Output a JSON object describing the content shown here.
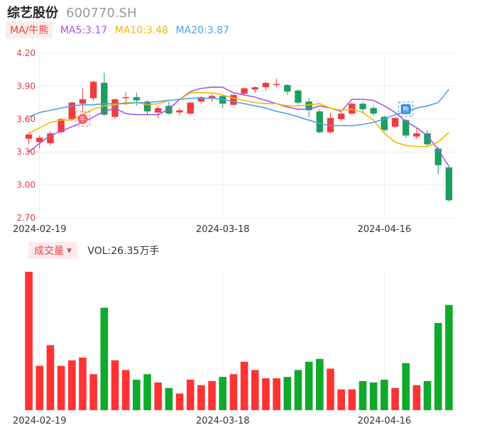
{
  "header": {
    "name": "综艺股份",
    "code": "600770.SH"
  },
  "ma": {
    "tab_label": "MA/牛熊",
    "items": [
      {
        "label": "MA5:3.17",
        "color": "#a855e8"
      },
      {
        "label": "MA10:3.48",
        "color": "#f5b800"
      },
      {
        "label": "MA20:3.87",
        "color": "#4b9ff0"
      }
    ]
  },
  "volume": {
    "tab_label": "成交量",
    "caret": "▼",
    "value_text": "VOL:26.35万手"
  },
  "colors": {
    "up": "#f03c3c",
    "down": "#1b9e5e",
    "vol_up": "#ff3333",
    "vol_down": "#0faa2b",
    "grid": "#ebebeb"
  },
  "badges": {
    "bull": "牛",
    "bear": "熊"
  },
  "chart_data": {
    "type": "candlestick",
    "y_ticks": [
      "4.20",
      "3.90",
      "3.60",
      "3.30",
      "3.00",
      "2.70"
    ],
    "ylim": [
      2.7,
      4.2
    ],
    "x_tick_labels": [
      {
        "label": "2024-02-19",
        "index": 1
      },
      {
        "label": "2024-03-18",
        "index": 18
      },
      {
        "label": "2024-04-16",
        "index": 33
      }
    ],
    "candles": [
      {
        "o": 3.42,
        "c": 3.46,
        "h": 3.48,
        "l": 3.37
      },
      {
        "o": 3.39,
        "c": 3.43,
        "h": 3.45,
        "l": 3.33
      },
      {
        "o": 3.38,
        "c": 3.47,
        "h": 3.49,
        "l": 3.36
      },
      {
        "o": 3.48,
        "c": 3.6,
        "h": 3.61,
        "l": 3.47
      },
      {
        "o": 3.6,
        "c": 3.75,
        "h": 3.76,
        "l": 3.59
      },
      {
        "o": 3.74,
        "c": 3.78,
        "h": 3.88,
        "l": 3.66
      },
      {
        "o": 3.79,
        "c": 3.94,
        "h": 3.95,
        "l": 3.77
      },
      {
        "o": 3.93,
        "c": 3.64,
        "h": 4.02,
        "l": 3.63
      },
      {
        "o": 3.62,
        "c": 3.78,
        "h": 3.79,
        "l": 3.6
      },
      {
        "o": 3.79,
        "c": 3.8,
        "h": 3.85,
        "l": 3.73
      },
      {
        "o": 3.8,
        "c": 3.77,
        "h": 3.84,
        "l": 3.72
      },
      {
        "o": 3.76,
        "c": 3.67,
        "h": 3.77,
        "l": 3.64
      },
      {
        "o": 3.66,
        "c": 3.7,
        "h": 3.72,
        "l": 3.61
      },
      {
        "o": 3.72,
        "c": 3.65,
        "h": 3.76,
        "l": 3.64
      },
      {
        "o": 3.66,
        "c": 3.68,
        "h": 3.7,
        "l": 3.63
      },
      {
        "o": 3.65,
        "c": 3.75,
        "h": 3.76,
        "l": 3.64
      },
      {
        "o": 3.76,
        "c": 3.8,
        "h": 3.81,
        "l": 3.74
      },
      {
        "o": 3.79,
        "c": 3.81,
        "h": 3.83,
        "l": 3.76
      },
      {
        "o": 3.81,
        "c": 3.74,
        "h": 3.82,
        "l": 3.7
      },
      {
        "o": 3.73,
        "c": 3.82,
        "h": 3.83,
        "l": 3.72
      },
      {
        "o": 3.83,
        "c": 3.88,
        "h": 3.89,
        "l": 3.81
      },
      {
        "o": 3.87,
        "c": 3.89,
        "h": 3.9,
        "l": 3.84
      },
      {
        "o": 3.89,
        "c": 3.93,
        "h": 3.94,
        "l": 3.86
      },
      {
        "o": 3.92,
        "c": 3.92,
        "h": 3.97,
        "l": 3.89
      },
      {
        "o": 3.91,
        "c": 3.85,
        "h": 3.92,
        "l": 3.82
      },
      {
        "o": 3.86,
        "c": 3.75,
        "h": 3.87,
        "l": 3.73
      },
      {
        "o": 3.76,
        "c": 3.68,
        "h": 3.79,
        "l": 3.62
      },
      {
        "o": 3.67,
        "c": 3.48,
        "h": 3.69,
        "l": 3.47
      },
      {
        "o": 3.48,
        "c": 3.61,
        "h": 3.66,
        "l": 3.47
      },
      {
        "o": 3.6,
        "c": 3.65,
        "h": 3.66,
        "l": 3.58
      },
      {
        "o": 3.65,
        "c": 3.74,
        "h": 3.75,
        "l": 3.64
      },
      {
        "o": 3.74,
        "c": 3.69,
        "h": 3.76,
        "l": 3.65
      },
      {
        "o": 3.7,
        "c": 3.65,
        "h": 3.72,
        "l": 3.63
      },
      {
        "o": 3.62,
        "c": 3.5,
        "h": 3.63,
        "l": 3.49
      },
      {
        "o": 3.53,
        "c": 3.61,
        "h": 3.62,
        "l": 3.52
      },
      {
        "o": 3.59,
        "c": 3.45,
        "h": 3.6,
        "l": 3.43
      },
      {
        "o": 3.44,
        "c": 3.47,
        "h": 3.52,
        "l": 3.42
      },
      {
        "o": 3.47,
        "c": 3.37,
        "h": 3.5,
        "l": 3.35
      },
      {
        "o": 3.33,
        "c": 3.18,
        "h": 3.35,
        "l": 3.1
      },
      {
        "o": 3.16,
        "c": 2.86,
        "h": 3.17,
        "l": 2.85
      }
    ],
    "volumes": [
      100,
      32,
      47,
      32,
      36,
      38,
      26,
      74,
      36,
      29,
      22,
      26,
      20,
      16,
      12,
      22,
      18,
      21,
      24,
      26,
      35,
      29,
      23,
      23,
      24,
      29,
      35,
      37,
      30,
      15,
      15,
      21,
      20,
      22,
      16,
      34,
      18,
      21,
      63,
      76
    ],
    "series": [
      {
        "name": "MA5",
        "values": [
          3.3,
          3.38,
          3.45,
          3.49,
          3.53,
          3.57,
          3.62,
          3.67,
          3.7,
          3.65,
          3.64,
          3.64,
          3.64,
          3.69,
          3.78,
          3.85,
          3.88,
          3.89,
          3.89,
          3.84,
          3.82,
          3.8,
          3.77,
          3.74,
          3.71,
          3.69,
          3.69,
          3.72,
          3.7,
          3.67,
          3.78,
          3.78,
          3.77,
          3.72,
          3.66,
          3.58,
          3.52,
          3.45,
          3.32,
          3.17
        ]
      },
      {
        "name": "MA10",
        "values": [
          3.47,
          3.52,
          3.57,
          3.59,
          3.59,
          3.64,
          3.69,
          3.72,
          3.73,
          3.75,
          3.75,
          3.73,
          3.74,
          3.77,
          3.78,
          3.84,
          3.84,
          3.84,
          3.82,
          3.79,
          3.77,
          3.75,
          3.74,
          3.74,
          3.72,
          3.72,
          3.73,
          3.74,
          3.7,
          3.68,
          3.69,
          3.66,
          3.59,
          3.47,
          3.39,
          3.36,
          3.35,
          3.35,
          3.39,
          3.48
        ]
      },
      {
        "name": "MA20",
        "values": [
          3.62,
          3.66,
          3.68,
          3.7,
          3.72,
          3.73,
          3.73,
          3.74,
          3.74,
          3.74,
          3.75,
          3.75,
          3.76,
          3.77,
          3.78,
          3.79,
          3.79,
          3.79,
          3.78,
          3.76,
          3.74,
          3.72,
          3.7,
          3.67,
          3.65,
          3.62,
          3.59,
          3.56,
          3.54,
          3.54,
          3.54,
          3.55,
          3.57,
          3.6,
          3.64,
          3.67,
          3.7,
          3.72,
          3.75,
          3.87
        ]
      }
    ],
    "markers": [
      {
        "type": "bull",
        "index": 5,
        "price": 3.6
      },
      {
        "type": "bear",
        "index": 35,
        "price": 3.69
      }
    ]
  }
}
